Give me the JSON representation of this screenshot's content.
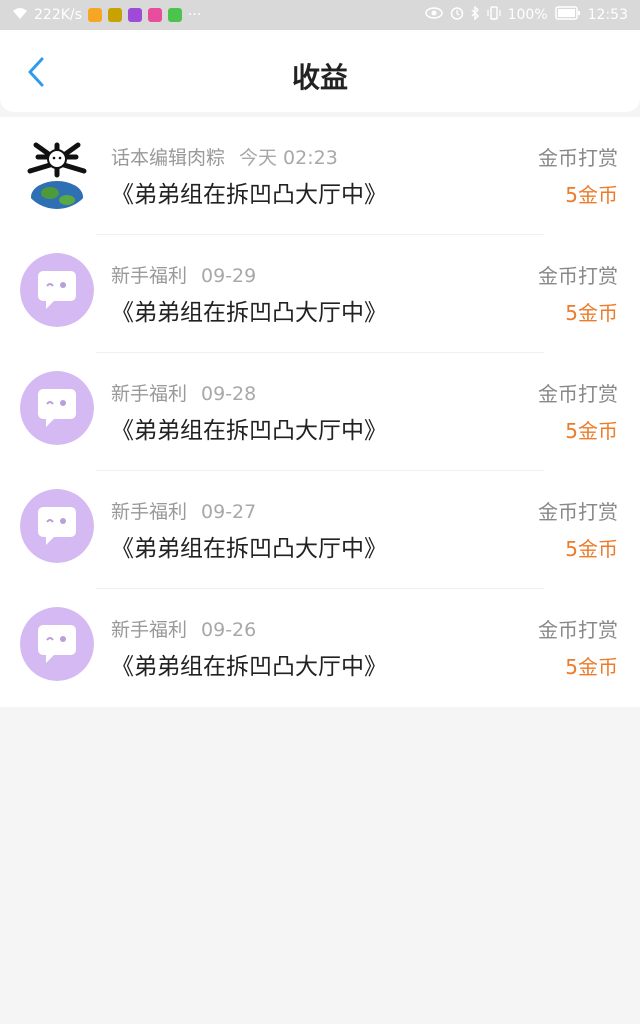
{
  "status_bar": {
    "speed": "222K/s",
    "more": "···",
    "battery": "100%",
    "time": "12:53",
    "app_colors": [
      "#f6a623",
      "#c8a200",
      "#a04bd8",
      "#e84c9c",
      "#4cc34c"
    ]
  },
  "header": {
    "title": "收益",
    "back_icon": "chevron-left-icon",
    "accent": "#2d9bf0"
  },
  "items": [
    {
      "name": "话本编辑肉粽",
      "date": "今天 02:23",
      "book": "《弟弟组在拆凹凸大厅中》",
      "type": "金币打赏",
      "amount": "5金币",
      "avatar": "editor-avatar"
    },
    {
      "name": "新手福利",
      "date": "09-29",
      "book": "《弟弟组在拆凹凸大厅中》",
      "type": "金币打赏",
      "amount": "5金币",
      "avatar": "chat-bubble-avatar"
    },
    {
      "name": "新手福利",
      "date": "09-28",
      "book": "《弟弟组在拆凹凸大厅中》",
      "type": "金币打赏",
      "amount": "5金币",
      "avatar": "chat-bubble-avatar"
    },
    {
      "name": "新手福利",
      "date": "09-27",
      "book": "《弟弟组在拆凹凸大厅中》",
      "type": "金币打赏",
      "amount": "5金币",
      "avatar": "chat-bubble-avatar"
    },
    {
      "name": "新手福利",
      "date": "09-26",
      "book": "《弟弟组在拆凹凸大厅中》",
      "type": "金币打赏",
      "amount": "5金币",
      "avatar": "chat-bubble-avatar"
    }
  ],
  "colors": {
    "amount": "#ec7b2b",
    "avatar_bg": "#d5b9f2"
  }
}
